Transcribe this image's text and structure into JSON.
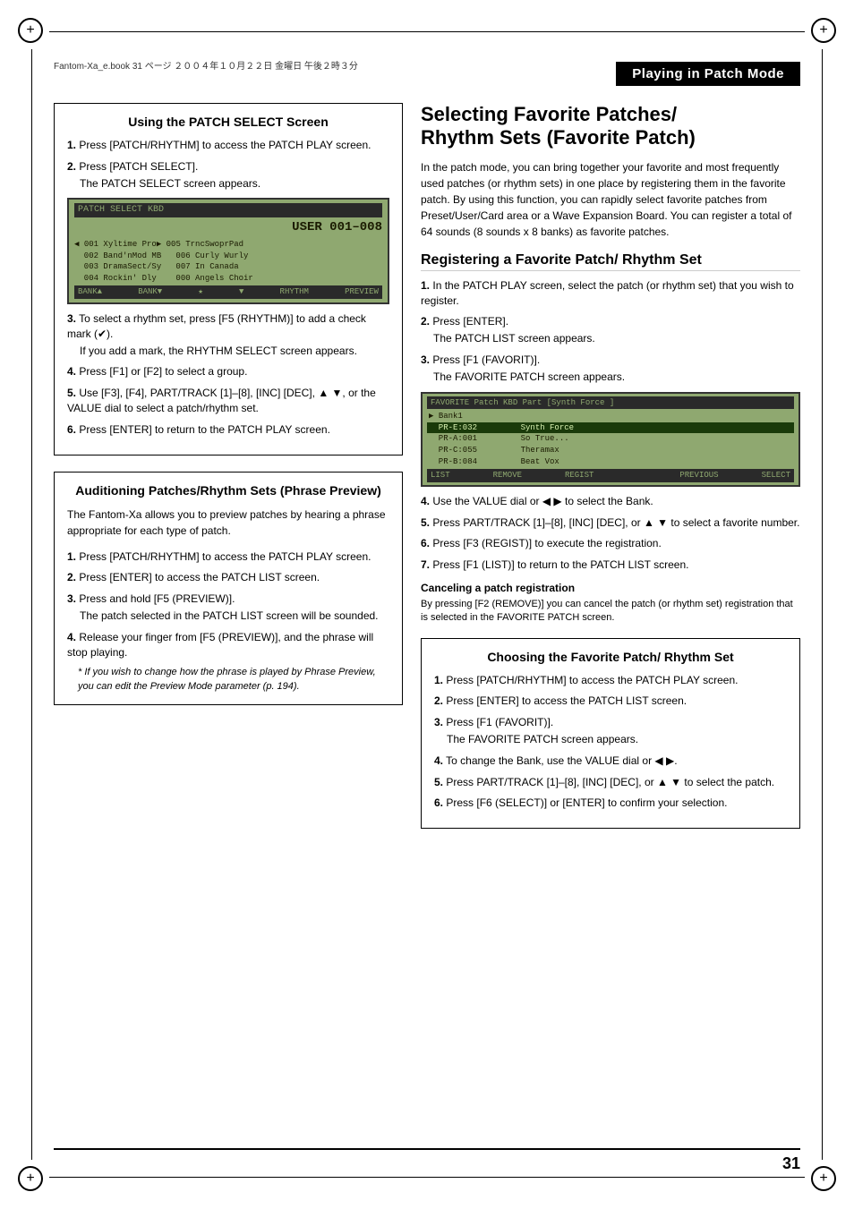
{
  "page": {
    "number": "31",
    "header_small": "Fantom-Xa_e.book  31 ページ  ２００４年１０月２２日  金曜日  午後２時３分",
    "title": "Playing in Patch Mode"
  },
  "left_column": {
    "section1": {
      "title": "Using the PATCH SELECT Screen",
      "steps": [
        {
          "num": "1.",
          "text": "Press [PATCH/RHYTHM] to access the PATCH PLAY screen."
        },
        {
          "num": "2.",
          "text": "Press [PATCH SELECT].",
          "sub": "The PATCH SELECT screen appears."
        },
        {
          "num": "3.",
          "text": "To select a rhythm set, press [F5 (RHYTHM)] to add a check mark (✔).",
          "sub": "If you add a mark, the RHYTHM SELECT screen appears."
        },
        {
          "num": "4.",
          "text": "Press [F1] or [F2] to select a group."
        },
        {
          "num": "5.",
          "text": "Use [F3], [F4], PART/TRACK [1]–[8], [INC] [DEC], ▲ ▼, or the VALUE dial to select a patch/rhythm set."
        },
        {
          "num": "6.",
          "text": "Press [ENTER] to return to the PATCH PLAY screen."
        }
      ],
      "lcd": {
        "top_bar_left": "PATCH SELECT  KBD",
        "top_bar_right": "",
        "title_big": "USER 001–008",
        "rows": [
          "◀ 001 Xyltime Pro▶ 005 TrncSwoprPad",
          "  002 Band'nMod MB   006 Curly Wurly",
          "  003 DramaSect/Sy   007 In Canada",
          "  004 Rockin' Dly    000 Angels Choir"
        ],
        "bottom_items": [
          "BANK▲",
          "BANK▼",
          "★",
          "▼",
          "RHYTHM",
          "PREVIEW"
        ]
      }
    },
    "section2": {
      "title": "Auditioning Patches/Rhythm Sets (Phrase Preview)",
      "intro": "The Fantom-Xa allows you to preview patches by hearing a phrase appropriate for each type of patch.",
      "steps": [
        {
          "num": "1.",
          "text": "Press [PATCH/RHYTHM] to access the PATCH PLAY screen."
        },
        {
          "num": "2.",
          "text": "Press [ENTER] to access the PATCH LIST screen."
        },
        {
          "num": "3.",
          "text": "Press and hold [F5 (PREVIEW)].",
          "sub": "The patch selected in the PATCH LIST screen will be sounded."
        },
        {
          "num": "4.",
          "text": "Release your finger from [F5 (PREVIEW)], and the phrase will stop playing."
        }
      ],
      "note": "* If you wish to change how the phrase is played by Phrase Preview, you can edit the Preview Mode parameter (p. 194)."
    }
  },
  "right_column": {
    "main_title_line1": "Selecting Favorite Patches/",
    "main_title_line2": "Rhythm Sets (Favorite Patch)",
    "intro": "In the patch mode, you can bring together your favorite and most frequently used patches (or rhythm sets) in one place by registering them in the favorite patch. By using this function, you can rapidly select favorite patches from Preset/User/Card area or a Wave Expansion Board. You can register a total of 64 sounds (8 sounds x 8 banks) as favorite patches.",
    "section_register": {
      "title": "Registering a Favorite Patch/ Rhythm Set",
      "steps": [
        {
          "num": "1.",
          "text": "In the PATCH PLAY screen, select the patch (or rhythm set) that you wish to register."
        },
        {
          "num": "2.",
          "text": "Press [ENTER].",
          "sub": "The PATCH LIST screen appears."
        },
        {
          "num": "3.",
          "text": "Press [F1 (FAVORIT)].",
          "sub": "The FAVORITE PATCH screen appears."
        }
      ],
      "lcd": {
        "top_bar": "FAVORITE Patch  KBD Part  [Synth Force ]",
        "rows": [
          "▶ Bank1",
          "  PR-E:032         Synth Force",
          "  PR-A:001         So True...",
          "  PR-C:055         Theramax",
          "  PR-B:084         Beat Vox"
        ],
        "bottom_items": [
          "LIST",
          "REMOVE",
          "REGIST",
          "",
          "PREVIOUS",
          "SELECT"
        ]
      },
      "steps_continued": [
        {
          "num": "4.",
          "text": "Use the VALUE dial or ◀ ▶ to select the Bank."
        },
        {
          "num": "5.",
          "text": "Press PART/TRACK [1]–[8], [INC] [DEC], or ▲ ▼ to select a favorite number."
        },
        {
          "num": "6.",
          "text": "Press [F3 (REGIST)] to execute the registration."
        },
        {
          "num": "7.",
          "text": "Press [F1 (LIST)] to return to the PATCH LIST screen."
        }
      ]
    },
    "section_cancel": {
      "title": "Canceling a patch registration",
      "text": "By pressing [F2 (REMOVE)] you can cancel the patch (or rhythm set) registration that is selected in the FAVORITE PATCH screen."
    },
    "section_choose": {
      "title": "Choosing the Favorite Patch/ Rhythm Set",
      "steps": [
        {
          "num": "1.",
          "text": "Press [PATCH/RHYTHM] to access the PATCH PLAY screen."
        },
        {
          "num": "2.",
          "text": "Press [ENTER] to access the PATCH LIST screen."
        },
        {
          "num": "3.",
          "text": "Press [F1 (FAVORIT)].",
          "sub": "The FAVORITE PATCH screen appears."
        },
        {
          "num": "4.",
          "text": "To change the Bank, use the VALUE dial or ◀ ▶."
        },
        {
          "num": "5.",
          "text": "Press PART/TRACK [1]–[8], [INC] [DEC], or ▲ ▼ to select the patch."
        },
        {
          "num": "6.",
          "text": "Press [F6 (SELECT)] or [ENTER] to confirm your selection."
        }
      ]
    }
  }
}
